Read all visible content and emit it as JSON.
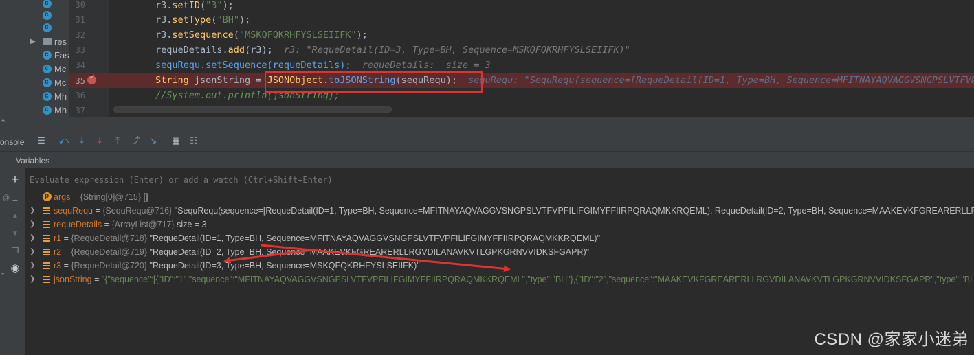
{
  "project_tree": {
    "items": [
      {
        "type": "class",
        "label": ""
      },
      {
        "type": "class",
        "label": ""
      },
      {
        "type": "class",
        "label": ""
      },
      {
        "type": "folder",
        "label": "res"
      },
      {
        "type": "class",
        "label": "Fas"
      },
      {
        "type": "class",
        "label": "Mc"
      },
      {
        "type": "class",
        "label": "Mc"
      },
      {
        "type": "class",
        "label": "Mh"
      },
      {
        "type": "class",
        "label": "Mh"
      }
    ]
  },
  "editor": {
    "line_numbers": [
      "30",
      "31",
      "32",
      "33",
      "34",
      "35",
      "36",
      "37"
    ],
    "lines": [
      {
        "code": "r3.setID(\"3\");"
      },
      {
        "code": "r3.setType(\"BH\");"
      },
      {
        "code": "r3.setSequence(\"MSKQFQKRHFYSLSEIIFK\");"
      },
      {
        "code": "requeDetails.add(r3);",
        "hint": "r3: \"RequeDetail(ID=3, Type=BH, Sequence=MSKQFQKRHFYSLSEIIFK)\""
      },
      {
        "code": "sequRequ.setSequence(requeDetails);",
        "hint": "requeDetails:  size = 3"
      },
      {
        "code": "String jsonString = JSONObject.toJSONString(sequRequ);",
        "hint": "sequRequ: \"SequRequ(sequence=[RequeDetail(ID=1, Type=BH, Sequence=MFITNAYAQVAGGVSNGPSLVTFVPFI"
      },
      {
        "code": "//System.out.println(jsonString);"
      }
    ],
    "breakpoint_line": "35"
  },
  "debug": {
    "console_tab": "onsole",
    "variables_title": "Variables",
    "eval_placeholder": "Evaluate expression (Enter) or add a watch (Ctrl+Shift+Enter)",
    "variables": [
      {
        "name": "args",
        "type": "{String[0]@715}",
        "value": "[]",
        "icon": "param",
        "expandable": false
      },
      {
        "name": "sequRequ",
        "type": "{SequRequ@716}",
        "value": "\"SequRequ(sequence=[RequeDetail(ID=1, Type=BH, Sequence=MFITNAYAQVAGGVSNGPSLVTFVPFILIFGIMYFFIIRPQRAQMKKRQEML), RequeDetail(ID=2, Type=BH, Sequence=MAAKEVKFGREARERLLRGVDILANAV",
        "icon": "field",
        "expandable": true
      },
      {
        "name": "requeDetails",
        "type": "{ArrayList@717}",
        "value": " size = 3",
        "icon": "field",
        "expandable": true
      },
      {
        "name": "r1",
        "type": "{RequeDetail@718}",
        "value": "\"RequeDetail(ID=1, Type=BH, Sequence=MFITNAYAQVAGGVSNGPSLVTFVPFILIFGIMYFFIIRPQRAQMKKRQEML)\"",
        "icon": "field",
        "expandable": true
      },
      {
        "name": "r2",
        "type": "{RequeDetail@719}",
        "value": "\"RequeDetail(ID=2, Type=BH, Sequence=MAAKEVKFGREARERLLRGVDILANAVKVTLGPKGRNVVIDKSFGAPR)\"",
        "icon": "field",
        "expandable": true
      },
      {
        "name": "r3",
        "type": "{RequeDetail@720}",
        "value": "\"RequeDetail(ID=3, Type=BH, Sequence=MSKQFQKRHFYSLSEIIFK)\"",
        "icon": "field",
        "expandable": true
      },
      {
        "name": "jsonString",
        "type": "",
        "value": "\"{\"sequence\":[{\"ID\":\"1\",\"sequence\":\"MFITNAYAQVAGGVSNGPSLVTFVPFILIFGIMYFFIIRPQRAQMKKRQEML\",\"type\":\"BH\"},{\"ID\":\"2\",\"sequence\":\"MAAKEVKFGREARERLLRGVDILANAVKVTLGPKGRNVVIDKSFGAPR\",\"type\":\"BH\"},{\"",
        "icon": "field",
        "expandable": true
      }
    ]
  },
  "watermark": "CSDN @家家小迷弟",
  "colors": {
    "breakpoint_line": "#5c2b2b",
    "annotation_red": "#e0322e"
  }
}
